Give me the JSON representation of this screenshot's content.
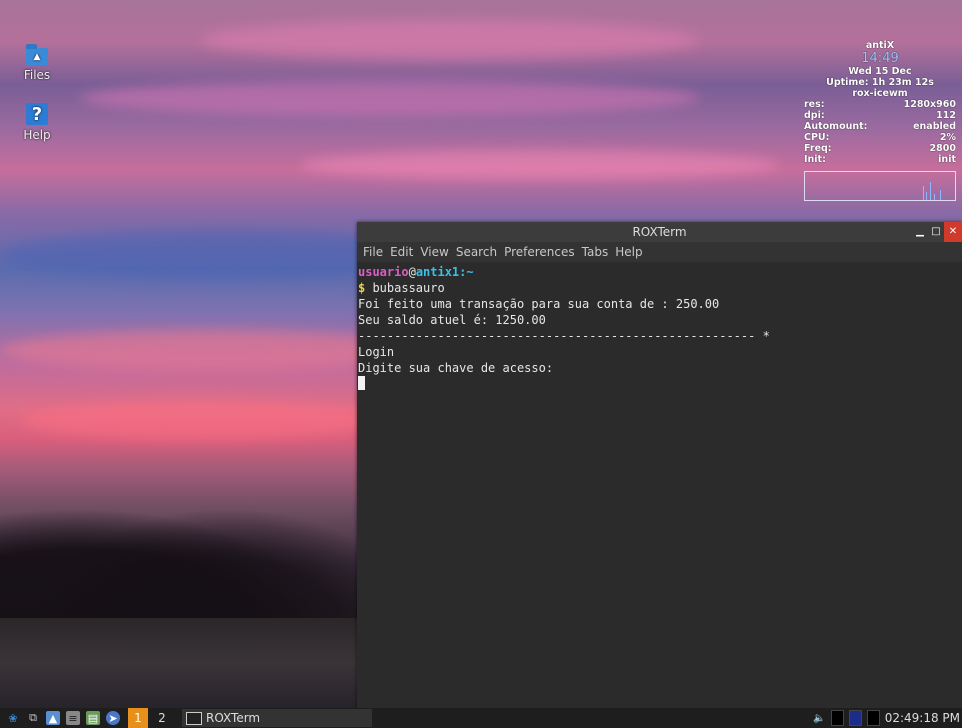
{
  "desktop": {
    "icons": [
      {
        "label": "Files",
        "icon": "folder-icon"
      },
      {
        "label": "Help",
        "icon": "help-icon",
        "glyph": "?"
      }
    ]
  },
  "conky": {
    "distro": "antiX",
    "time": "14:49",
    "date": "Wed 15 Dec",
    "uptime": "Uptime: 1h 23m 12s",
    "wm": "rox-icewm",
    "stats": [
      {
        "label": "res:",
        "value": "1280x960"
      },
      {
        "label": "dpi:",
        "value": "112"
      },
      {
        "label": "Automount:",
        "value": "enabled"
      },
      {
        "label": "CPU:",
        "value": "2%"
      },
      {
        "label": "Freq:",
        "value": "2800"
      },
      {
        "label": "Init:",
        "value": "init"
      }
    ]
  },
  "window": {
    "title": "ROXTerm",
    "menu": [
      "File",
      "Edit",
      "View",
      "Search",
      "Preferences",
      "Tabs",
      "Help"
    ]
  },
  "terminal": {
    "user": "usuario",
    "at": "@",
    "host": "antix1",
    "path": ":~",
    "prompt": "$",
    "command": " bubassauro",
    "lines": [
      "",
      "Foi feito uma transação para sua conta de : 250.00",
      "Seu saldo atuel é: 1250.00",
      "------------------------------------------------------- *",
      "",
      "Login",
      "Digite sua chave de acesso:"
    ]
  },
  "taskbar": {
    "workspaces": [
      "1",
      "2"
    ],
    "task_label": "ROXTerm",
    "clock": "02:49:18 PM"
  }
}
